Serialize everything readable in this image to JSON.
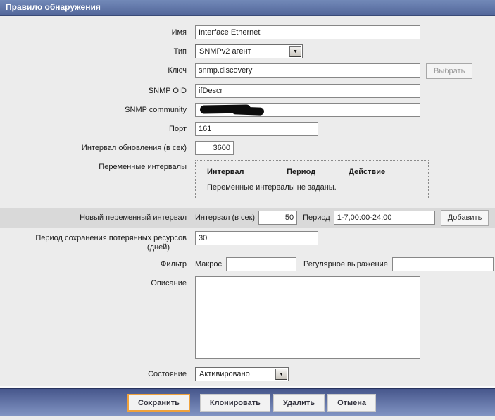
{
  "header": {
    "title": "Правило обнаружения"
  },
  "icons": {
    "dropdown_arrow": "▼",
    "resize_grip": ".:"
  },
  "colors": {
    "header_blue_top": "#7289b8",
    "header_blue_bottom": "#54689b",
    "footer_blue_top": "#47578c",
    "footer_blue_bottom": "#8295c4",
    "band_gray": "#d9d9d9",
    "save_button_border": "#f0a23c",
    "page_background": "#ececec"
  },
  "form": {
    "name": {
      "label": "Имя",
      "value": "Interface Ethernet"
    },
    "type": {
      "label": "Тип",
      "value": "SNMPv2 агент"
    },
    "key": {
      "label": "Ключ",
      "value": "snmp.discovery",
      "select_button": "Выбрать"
    },
    "snmp_oid": {
      "label": "SNMP OID",
      "value": "ifDescr"
    },
    "snmp_community": {
      "label": "SNMP community",
      "value": ""
    },
    "port": {
      "label": "Порт",
      "value": "161"
    },
    "update_interval": {
      "label": "Интервал обновления (в сек)",
      "value": "3600"
    },
    "flexible_intervals": {
      "label": "Переменные интервалы",
      "columns": [
        "Интервал",
        "Период",
        "Действие"
      ],
      "empty_text": "Переменные интервалы не заданы."
    },
    "new_flexible_interval": {
      "label": "Новый переменный интервал",
      "interval_label": "Интервал (в сек)",
      "interval_value": "50",
      "period_label": "Период",
      "period_value": "1-7,00:00-24:00",
      "add_button": "Добавить"
    },
    "keep_lost_resources": {
      "label_line1": "Период сохранения потерянных ресурсов",
      "label_line2": "(дней)",
      "value": "30"
    },
    "filter": {
      "label": "Фильтр",
      "macro_label": "Макрос",
      "macro_value": "",
      "regexp_label": "Регулярное выражение",
      "regexp_value": ""
    },
    "description": {
      "label": "Описание",
      "value": ""
    },
    "status": {
      "label": "Состояние",
      "value": "Активировано"
    }
  },
  "footer": {
    "save": "Сохранить",
    "clone": "Клонировать",
    "delete": "Удалить",
    "cancel": "Отмена"
  }
}
